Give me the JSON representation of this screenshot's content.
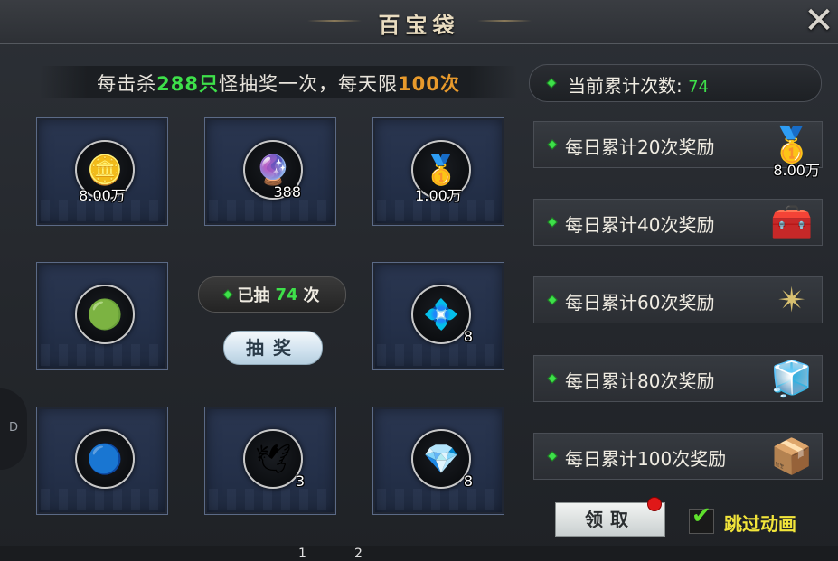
{
  "window": {
    "title": "百宝袋",
    "close_glyph": "✕"
  },
  "info": {
    "prefix": "每击杀",
    "kills": "288只",
    "middle": "怪抽奖一次，每天限",
    "limit": "100次"
  },
  "grid": [
    {
      "qty": "8.00万",
      "icon": "gold-coins-icon",
      "glyph": "🪙"
    },
    {
      "qty": "388",
      "icon": "spirit-orb-icon",
      "glyph": "🔮"
    },
    {
      "qty": "1.00万",
      "icon": "gold-ingot-icon",
      "glyph": "🥇"
    },
    {
      "qty": "",
      "icon": "jade-orb-icon",
      "glyph": "🟢"
    },
    {
      "qty": "8",
      "icon": "blue-ring-icon",
      "glyph": "💠"
    },
    {
      "qty": "",
      "icon": "blue-gem-icon",
      "glyph": "🔵"
    },
    {
      "qty": "3",
      "icon": "wings-icon",
      "glyph": "🕊"
    },
    {
      "qty": "8",
      "icon": "dark-crystal-icon",
      "glyph": "💎"
    }
  ],
  "drawn": {
    "label_before": "已抽",
    "count": "74",
    "label_after": "次"
  },
  "lottery_button": "抽奖",
  "current": {
    "label": "当前累计次数:",
    "value": "74"
  },
  "rewards": [
    {
      "label": "每日累计20次奖励",
      "icon": "gold-ingot-icon",
      "glyph": "🥇",
      "qty": "8.00万"
    },
    {
      "label": "每日累计40次奖励",
      "icon": "treasure-chest-icon",
      "glyph": "🧰",
      "qty": ""
    },
    {
      "label": "每日累计60次奖励",
      "icon": "golden-ornament-icon",
      "glyph": "✴",
      "qty": ""
    },
    {
      "label": "每日累计80次奖励",
      "icon": "crystal-chest-icon",
      "glyph": "🧊",
      "qty": ""
    },
    {
      "label": "每日累计100次奖励",
      "icon": "golden-chest-icon",
      "glyph": "📦",
      "qty": ""
    }
  ],
  "claim_button": "领取",
  "skip_animation": {
    "label": "跳过动画",
    "checked": true
  },
  "side_tab": "D",
  "pages": [
    "1",
    "2"
  ]
}
